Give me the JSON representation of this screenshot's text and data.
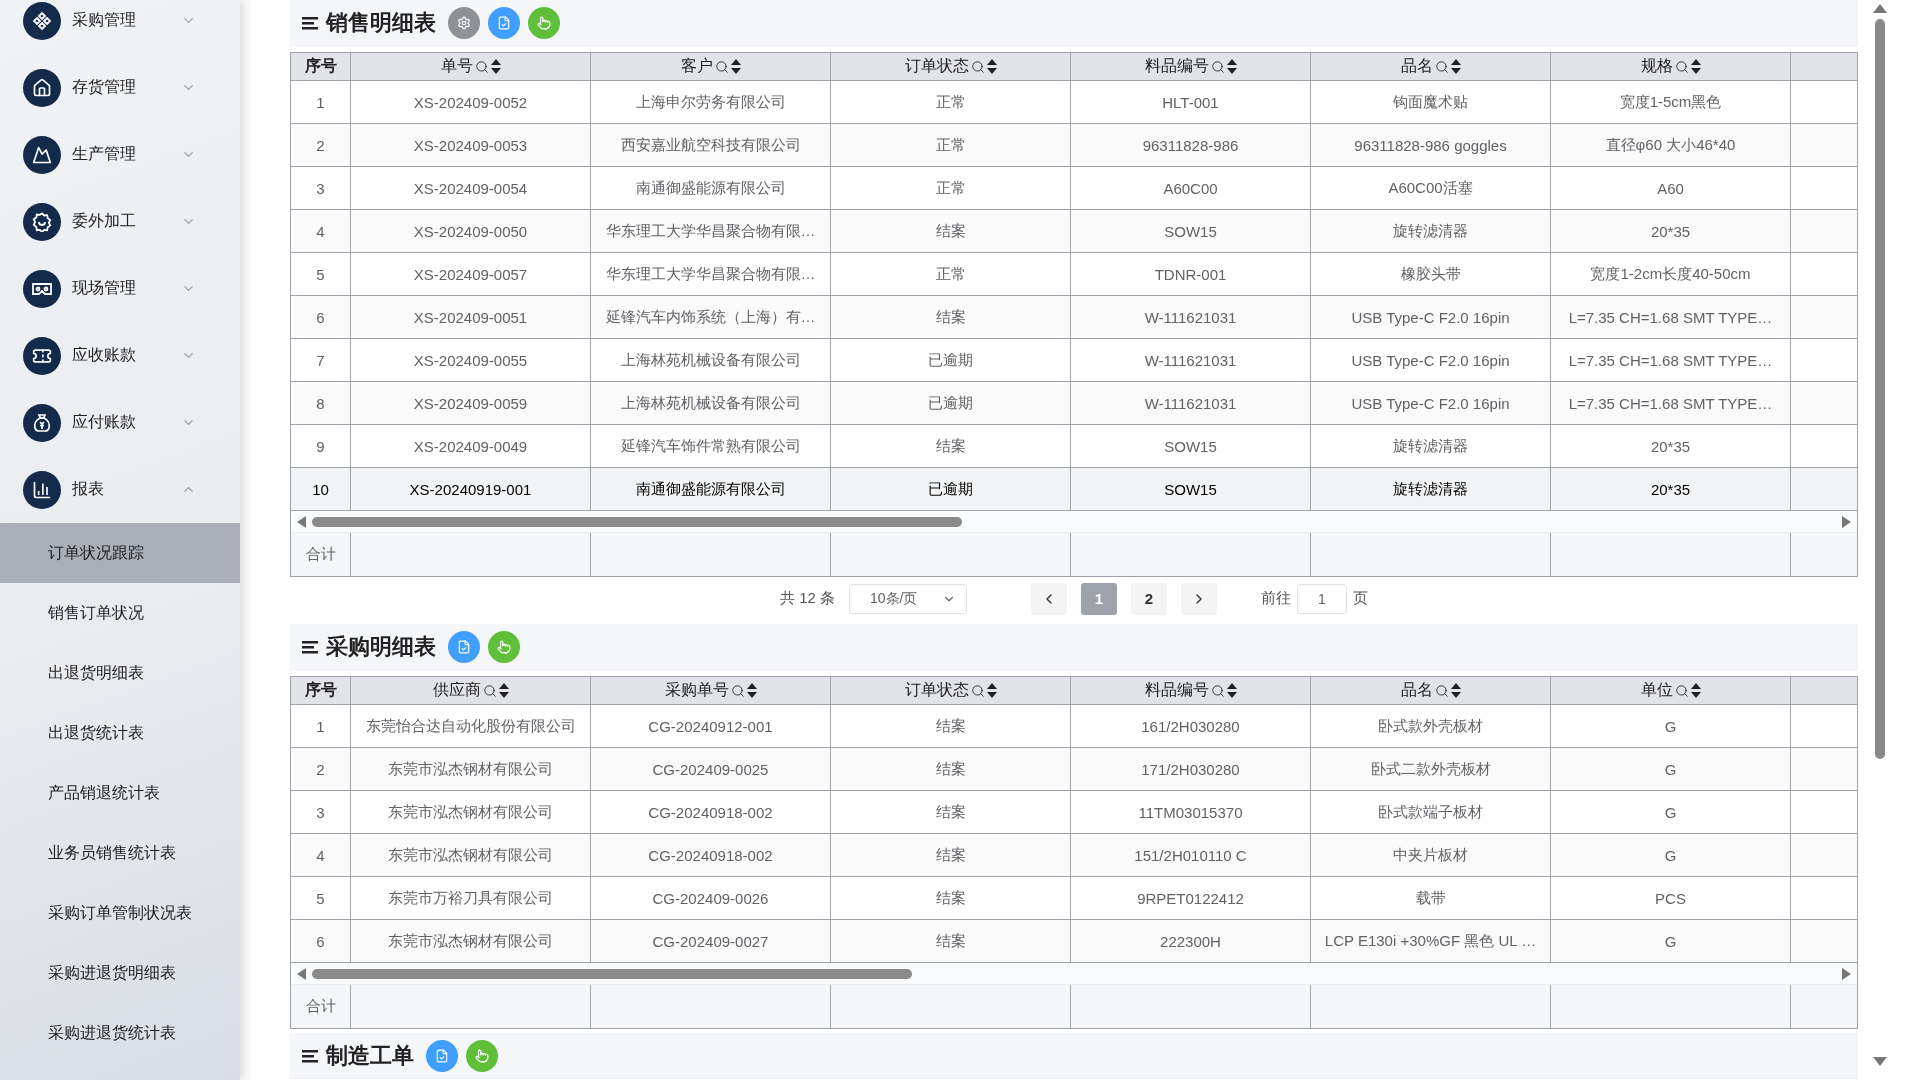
{
  "sidebar": {
    "menus": [
      {
        "label": "采购管理",
        "expanded": false
      },
      {
        "label": "存货管理",
        "expanded": false
      },
      {
        "label": "生产管理",
        "expanded": false
      },
      {
        "label": "委外加工",
        "expanded": false
      },
      {
        "label": "现场管理",
        "expanded": false
      },
      {
        "label": "应收账款",
        "expanded": false
      },
      {
        "label": "应付账款",
        "expanded": false
      },
      {
        "label": "报表",
        "expanded": true,
        "children": [
          {
            "label": "订单状况跟踪",
            "selected": true
          },
          {
            "label": "销售订单状况",
            "selected": false
          },
          {
            "label": "出退货明细表",
            "selected": false
          },
          {
            "label": "出退货统计表",
            "selected": false
          },
          {
            "label": "产品销退统计表",
            "selected": false
          },
          {
            "label": "业务员销售统计表",
            "selected": false
          },
          {
            "label": "采购订单管制状况表",
            "selected": false
          },
          {
            "label": "采购进退货明细表",
            "selected": false
          },
          {
            "label": "采购进退货统计表",
            "selected": false
          }
        ]
      }
    ]
  },
  "sections": [
    {
      "title": "销售明细表",
      "buttons": [
        {
          "kind": "settings"
        },
        {
          "kind": "export"
        },
        {
          "kind": "touch"
        }
      ],
      "table": {
        "columns": [
          {
            "label": "序号",
            "filterable": false
          },
          {
            "label": "单号",
            "filterable": true
          },
          {
            "label": "客户",
            "filterable": true
          },
          {
            "label": "订单状态",
            "filterable": true
          },
          {
            "label": "料品编号",
            "filterable": true
          },
          {
            "label": "品名",
            "filterable": true
          },
          {
            "label": "规格",
            "filterable": true
          }
        ],
        "rows": [
          {
            "cells": [
              "1",
              "XS-202409-0052",
              "上海申尔劳务有限公司",
              "正常",
              "HLT-001",
              "钩面魔术贴",
              "宽度1-5cm黑色"
            ],
            "selected": false
          },
          {
            "cells": [
              "2",
              "XS-202409-0053",
              "西安嘉业航空科技有限公司",
              "正常",
              "96311828-986",
              "96311828-986 goggles",
              "直径φ60 大小46*40"
            ],
            "selected": false
          },
          {
            "cells": [
              "3",
              "XS-202409-0054",
              "南通御盛能源有限公司",
              "正常",
              "A60C00",
              "A60C00活塞",
              "A60"
            ],
            "selected": false
          },
          {
            "cells": [
              "4",
              "XS-202409-0050",
              "华东理工大学华昌聚合物有限…",
              "结案",
              "SOW15",
              "旋转滤清器",
              "20*35"
            ],
            "selected": false
          },
          {
            "cells": [
              "5",
              "XS-202409-0057",
              "华东理工大学华昌聚合物有限…",
              "正常",
              "TDNR-001",
              "橡胶头带",
              "宽度1-2cm长度40-50cm"
            ],
            "selected": false
          },
          {
            "cells": [
              "6",
              "XS-202409-0051",
              "延锋汽车内饰系统（上海）有…",
              "结案",
              "W-111621031",
              "USB Type-C F2.0 16pin",
              "L=7.35 CH=1.68 SMT TYPE…"
            ],
            "selected": false
          },
          {
            "cells": [
              "7",
              "XS-202409-0055",
              "上海林苑机械设备有限公司",
              "已逾期",
              "W-111621031",
              "USB Type-C F2.0 16pin",
              "L=7.35 CH=1.68 SMT TYPE…"
            ],
            "selected": false
          },
          {
            "cells": [
              "8",
              "XS-202409-0059",
              "上海林苑机械设备有限公司",
              "已逾期",
              "W-111621031",
              "USB Type-C F2.0 16pin",
              "L=7.35 CH=1.68 SMT TYPE…"
            ],
            "selected": false
          },
          {
            "cells": [
              "9",
              "XS-202409-0049",
              "延锋汽车饰件常熟有限公司",
              "结案",
              "SOW15",
              "旋转滤清器",
              "20*35"
            ],
            "selected": false
          },
          {
            "cells": [
              "10",
              "XS-20240919-001",
              "南通御盛能源有限公司",
              "已逾期",
              "SOW15",
              "旋转滤清器",
              "20*35"
            ],
            "selected": true
          }
        ],
        "total_label": "合计"
      },
      "pagination": {
        "total": "共 12 条",
        "page_size": "10条/页",
        "pages": [
          {
            "label": "1",
            "selected": true
          },
          {
            "label": "2",
            "selected": false
          }
        ],
        "goto_label": "前往",
        "goto_value": "1",
        "page_suffix": "页"
      }
    },
    {
      "title": "采购明细表",
      "buttons": [
        {
          "kind": "export"
        },
        {
          "kind": "touch"
        }
      ],
      "table": {
        "columns": [
          {
            "label": "序号",
            "filterable": false
          },
          {
            "label": "供应商",
            "filterable": true
          },
          {
            "label": "采购单号",
            "filterable": true
          },
          {
            "label": "订单状态",
            "filterable": true
          },
          {
            "label": "料品编号",
            "filterable": true
          },
          {
            "label": "品名",
            "filterable": true
          },
          {
            "label": "单位",
            "filterable": true
          }
        ],
        "rows": [
          {
            "cells": [
              "1",
              "东莞怡合达自动化股份有限公司",
              "CG-20240912-001",
              "结案",
              "161/2H030280",
              "卧式款外壳板材",
              "G"
            ],
            "selected": false
          },
          {
            "cells": [
              "2",
              "东莞市泓杰钢材有限公司",
              "CG-202409-0025",
              "结案",
              "171/2H030280",
              "卧式二款外壳板材",
              "G"
            ],
            "selected": false
          },
          {
            "cells": [
              "3",
              "东莞市泓杰钢材有限公司",
              "CG-20240918-002",
              "结案",
              "11TM03015370",
              "卧式款端子板材",
              "G"
            ],
            "selected": false
          },
          {
            "cells": [
              "4",
              "东莞市泓杰钢材有限公司",
              "CG-20240918-002",
              "结案",
              "151/2H010110 C",
              "中夹片板材",
              "G"
            ],
            "selected": false
          },
          {
            "cells": [
              "5",
              "东莞市万裕刀具有限公司",
              "CG-202409-0026",
              "结案",
              "9RPET0122412",
              "载带",
              "PCS"
            ],
            "selected": false
          },
          {
            "cells": [
              "6",
              "东莞市泓杰钢材有限公司",
              "CG-202409-0027",
              "结案",
              "222300H",
              "LCP E130i +30%GF 黑色 UL …",
              "G"
            ],
            "selected": false
          }
        ],
        "total_label": "合计"
      }
    },
    {
      "title": "制造工单",
      "buttons": [
        {
          "kind": "export"
        },
        {
          "kind": "touch"
        }
      ]
    }
  ]
}
